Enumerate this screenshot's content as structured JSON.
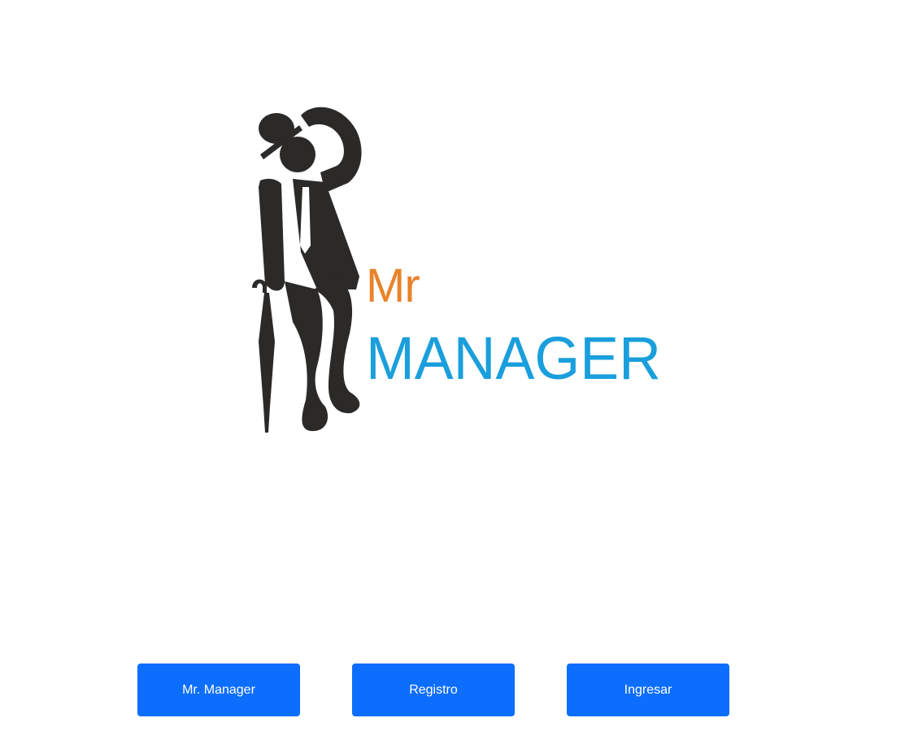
{
  "logo": {
    "word_mr": "Mr",
    "word_manager": "MANAGER",
    "figure_icon": "gentleman-with-umbrella-icon"
  },
  "buttons": {
    "mr_manager_label": "Mr. Manager",
    "registro_label": "Registro",
    "ingresar_label": "Ingresar"
  },
  "colors": {
    "figure": "#2b2a29",
    "mr_orange": "#e8832a",
    "manager_blue": "#1a9fdc",
    "button_blue": "#0d6efd",
    "background": "#ffffff"
  }
}
